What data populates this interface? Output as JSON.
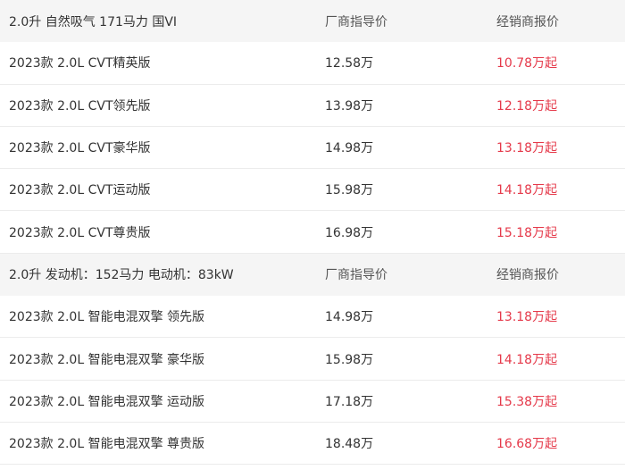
{
  "colors": {
    "group_header_bg": "#f5f5f5",
    "dealer_price_color": "#e5394a",
    "text_color": "#333333",
    "divider_color": "#ececec"
  },
  "groups": [
    {
      "title": "2.0升 自然吸气 171马力 国VI",
      "msrp_header": "厂商指导价",
      "dealer_header": "经销商报价",
      "models": [
        {
          "name": "2023款 2.0L CVT精英版",
          "msrp": "12.58万",
          "dealer": "10.78万起"
        },
        {
          "name": "2023款 2.0L CVT领先版",
          "msrp": "13.98万",
          "dealer": "12.18万起"
        },
        {
          "name": "2023款 2.0L CVT豪华版",
          "msrp": "14.98万",
          "dealer": "13.18万起"
        },
        {
          "name": "2023款 2.0L CVT运动版",
          "msrp": "15.98万",
          "dealer": "14.18万起"
        },
        {
          "name": "2023款 2.0L CVT尊贵版",
          "msrp": "16.98万",
          "dealer": "15.18万起"
        }
      ]
    },
    {
      "title": "2.0升 发动机：152马力 电动机：83kW",
      "msrp_header": "厂商指导价",
      "dealer_header": "经销商报价",
      "models": [
        {
          "name": "2023款 2.0L 智能电混双擎 领先版",
          "msrp": "14.98万",
          "dealer": "13.18万起"
        },
        {
          "name": "2023款 2.0L 智能电混双擎 豪华版",
          "msrp": "15.98万",
          "dealer": "14.18万起"
        },
        {
          "name": "2023款 2.0L 智能电混双擎 运动版",
          "msrp": "17.18万",
          "dealer": "15.38万起"
        },
        {
          "name": "2023款 2.0L 智能电混双擎 尊贵版",
          "msrp": "18.48万",
          "dealer": "16.68万起"
        }
      ]
    }
  ]
}
